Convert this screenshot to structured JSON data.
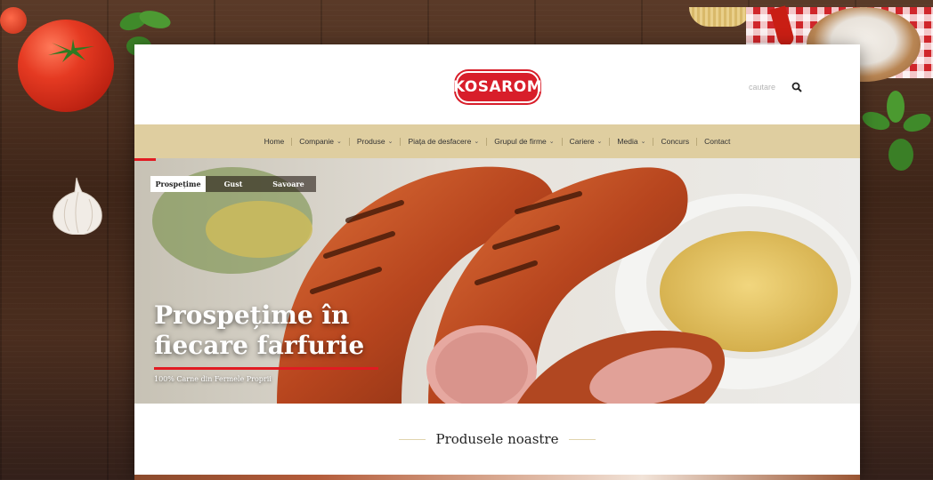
{
  "brand": {
    "logo_text": "KOSAROM",
    "accent": "#d81e2a",
    "nav_bg": "#dfcea0"
  },
  "search": {
    "placeholder": "cautare",
    "icon": "search-icon"
  },
  "nav": {
    "items": [
      {
        "label": "Home",
        "dropdown": false
      },
      {
        "label": "Companie",
        "dropdown": true
      },
      {
        "label": "Produse",
        "dropdown": true
      },
      {
        "label": "Piața de desfacere",
        "dropdown": true
      },
      {
        "label": "Grupul de firme",
        "dropdown": true
      },
      {
        "label": "Cariere",
        "dropdown": true
      },
      {
        "label": "Media",
        "dropdown": true
      },
      {
        "label": "Concurs",
        "dropdown": false
      },
      {
        "label": "Contact",
        "dropdown": false
      }
    ]
  },
  "hero": {
    "tabs": [
      {
        "label": "Prospețime",
        "active": true
      },
      {
        "label": "Gust",
        "active": false
      },
      {
        "label": "Savoare",
        "active": false
      }
    ],
    "title_line1": "Prospețime în",
    "title_line2": "fiecare farfurie",
    "subtitle": "100% Carne din Fermele Proprii"
  },
  "products": {
    "title": "Produsele noastre"
  }
}
